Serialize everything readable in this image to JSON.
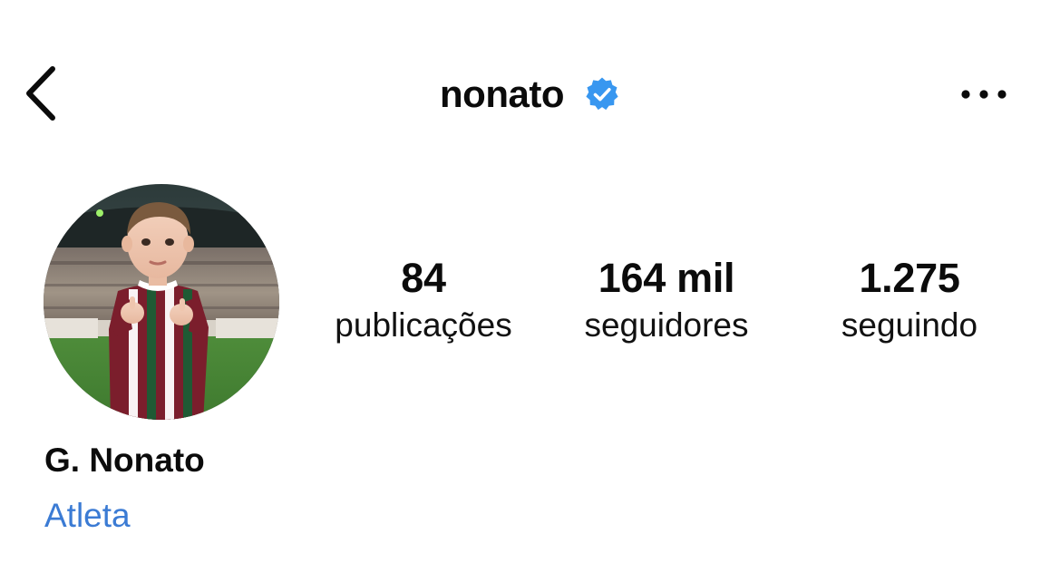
{
  "header": {
    "username": "nonato",
    "back_icon": "chevron-left-icon",
    "verified_icon": "verified-badge-icon",
    "more_icon": "more-horizontal-icon"
  },
  "profile": {
    "avatar_description_icon": "avatar-photo",
    "stats": [
      {
        "value": "84",
        "label": "publicações"
      },
      {
        "value": "164 mil",
        "label": "seguidores"
      },
      {
        "value": "1.275",
        "label": "seguindo"
      }
    ],
    "display_name": "G. Nonato",
    "category": "Atleta"
  },
  "colors": {
    "verified": "#3897f0",
    "category_link": "#3b7bd4",
    "text": "#0b0b0b"
  }
}
